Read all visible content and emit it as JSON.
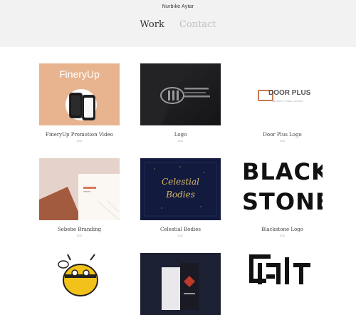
{
  "site": {
    "name": "Nurbike Aytar"
  },
  "nav": {
    "work": "Work",
    "contact": "Contact"
  },
  "projects": [
    {
      "title": "FineryUp Promotion Video",
      "year": "2022",
      "thumb_text": "FineryUp"
    },
    {
      "title": "Logo",
      "year": "2022"
    },
    {
      "title": "Door Plus Logo",
      "year": "2022",
      "thumb_text": "DOOR PLUS",
      "thumb_sub": "SECURITY STEEL DOORS"
    },
    {
      "title": "Sebebe Branding",
      "year": "2022"
    },
    {
      "title": "Celestial Bodies",
      "year": "2022",
      "thumb_line1": "Celestial",
      "thumb_line2": "Bodies"
    },
    {
      "title": "Blackstone Logo",
      "year": "2022",
      "thumb_line1": "BLACK",
      "thumb_line2": "STONE"
    },
    {
      "title": "",
      "year": ""
    },
    {
      "title": "",
      "year": ""
    },
    {
      "title": "",
      "year": ""
    }
  ],
  "colors": {
    "topbar": "#f2f2f2",
    "finery_bg": "#e8b48f",
    "door_accent": "#c77a52",
    "celestial_bg": "#121a3d",
    "gold": "#d9b86a"
  }
}
